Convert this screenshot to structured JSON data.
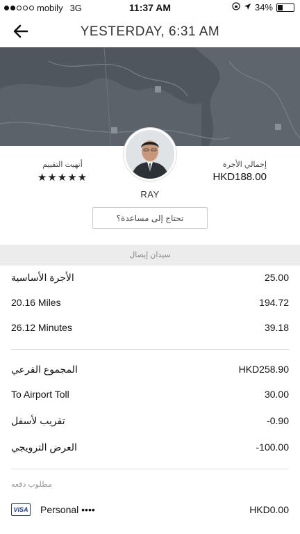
{
  "status_bar": {
    "carrier": "mobily",
    "network": "3G",
    "time": "11:37 AM",
    "battery": "34%",
    "battery_level": 0.34
  },
  "header": {
    "title": "YESTERDAY, 6:31 AM",
    "back_icon": "arrow-left-icon"
  },
  "trip": {
    "rating_label": "أنهيت التقييم",
    "rating_stars": "★★★★★",
    "fare_label": "إجمالي الأجرة",
    "fare_total": "HKD188.00",
    "driver_name": "RAY",
    "help_button": "تحتاج إلى مساعدة؟"
  },
  "vehicle": {
    "type": "سيدان إيصال"
  },
  "fare_breakdown": [
    {
      "label": "الأجرة الأساسية",
      "value": "25.00"
    },
    {
      "label": "20.16 Miles",
      "value": "194.72"
    },
    {
      "label": "26.12 Minutes",
      "value": "39.18"
    },
    {
      "label": "المجموع الفرعي",
      "value": "HKD258.90"
    },
    {
      "label": "To Airport Toll",
      "value": "30.00"
    },
    {
      "label": "تقريب لأسفل",
      "value": "-0.90"
    },
    {
      "label": "العرض الترويجي",
      "value": "-100.00"
    }
  ],
  "payment": {
    "label": "مطلوب دفعه",
    "card_brand": "VISA",
    "name": "Personal ••••",
    "amount": "HKD0.00"
  },
  "colors": {
    "map_bg": "#4a5058",
    "vehicle_bar_bg": "#ececec",
    "visa_blue": "#1a3a8c"
  }
}
